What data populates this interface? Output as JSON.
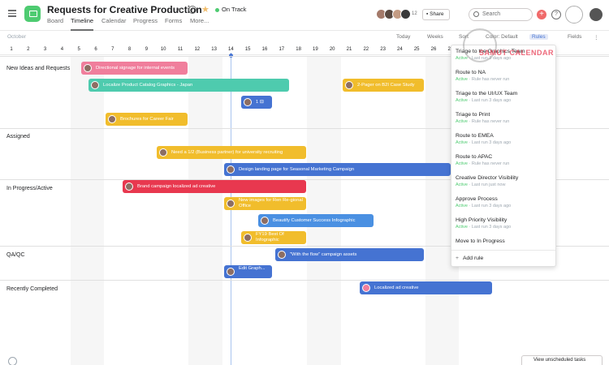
{
  "header": {
    "title": "Requests for Creative Production",
    "status": "On Track",
    "tabs": [
      "Board",
      "Timeline",
      "Calendar",
      "Progress",
      "Forms",
      "More..."
    ],
    "active_tab": "Timeline",
    "member_count": "12",
    "share_label": "Share",
    "search_placeholder": "Search"
  },
  "toolbar": {
    "month": "October",
    "today_label": "Today",
    "weeks_label": "Weeks",
    "sort_label": "Sort",
    "color_label": "Color: Default",
    "rules_label": "Rules",
    "fields_label": "Fields"
  },
  "days": [
    "1",
    "2",
    "3",
    "4",
    "5",
    "6",
    "7",
    "8",
    "9",
    "10",
    "11",
    "12",
    "13",
    "14",
    "15",
    "16",
    "17",
    "18",
    "19",
    "20",
    "21",
    "22",
    "23",
    "24",
    "25",
    "26",
    "27",
    "28",
    "29",
    "30",
    "31",
    "1"
  ],
  "sections": [
    {
      "label": "New Ideas and Requests"
    },
    {
      "label": "Assigned"
    },
    {
      "label": "In Progress/Active"
    },
    {
      "label": "QA/QC"
    },
    {
      "label": "Recently Completed"
    }
  ],
  "tasks": [
    {
      "label": "Directional signage for internal events",
      "color": "#f07e9c"
    },
    {
      "label": "Localize Product Catalog Graphics - Japan",
      "color": "#4ecbae"
    },
    {
      "label": "2-Pager on B2I Case Study",
      "color": "#f1bd2c"
    },
    {
      "label": "1",
      "subcount": "1",
      "color": "#4573d2"
    },
    {
      "label": "Brochures for Career Fair",
      "color": "#f1bd2c"
    },
    {
      "label": "Need a 1/2 (Business partner) for university recruiting",
      "color": "#f1bd2c"
    },
    {
      "label": "Design landing page for Seasonal Marketing Campaign",
      "color": "#4573d2"
    },
    {
      "label": "Brand campaign localized ad creative",
      "color": "#e8384f"
    },
    {
      "label": "New images for Ren Re-gional Office",
      "color": "#f1bd2c"
    },
    {
      "label": "Beautify Customer Success Infographic",
      "color": "#4a90e2"
    },
    {
      "label": "FY19 Best Of Infographic",
      "color": "#f1bd2c"
    },
    {
      "label": "\"With the flow\" campaign assets",
      "color": "#4573d2"
    },
    {
      "label": "Edit Graph...",
      "subcount": "1",
      "color": "#4573d2"
    },
    {
      "label": "Localized ad creative",
      "color": "#4573d2"
    }
  ],
  "rules": [
    {
      "name": "Triage to the Graphics Team",
      "state": "Active",
      "detail": "Last run 3 days ago"
    },
    {
      "name": "Route to NA",
      "state": "Active",
      "detail": "Rule has never run"
    },
    {
      "name": "Triage to the UI/UX Team",
      "state": "Active",
      "detail": "Last run 3 days ago"
    },
    {
      "name": "Triage to Print",
      "state": "Active",
      "detail": "Rule has never run"
    },
    {
      "name": "Route to EMEA",
      "state": "Active",
      "detail": "Last run 3 days ago"
    },
    {
      "name": "Route to APAC",
      "state": "Active",
      "detail": "Rule has never run"
    },
    {
      "name": "Creative Director Visibility",
      "state": "Active",
      "detail": "Last run just now"
    },
    {
      "name": "Approve Process",
      "state": "Active",
      "detail": "Last run 3 days ago"
    },
    {
      "name": "High Priority Visibility",
      "state": "Active",
      "detail": "Last run 3 days ago"
    },
    {
      "name": "Move to In Progress",
      "state": "",
      "detail": ""
    }
  ],
  "add_rule_label": "Add rule",
  "unscheduled_label": "View unscheduled tasks",
  "watermark": "SAMUT CALENDAR",
  "colors": {
    "accent": "#4573d2",
    "on_track": "#4ecb71",
    "add": "#f06a6a"
  }
}
